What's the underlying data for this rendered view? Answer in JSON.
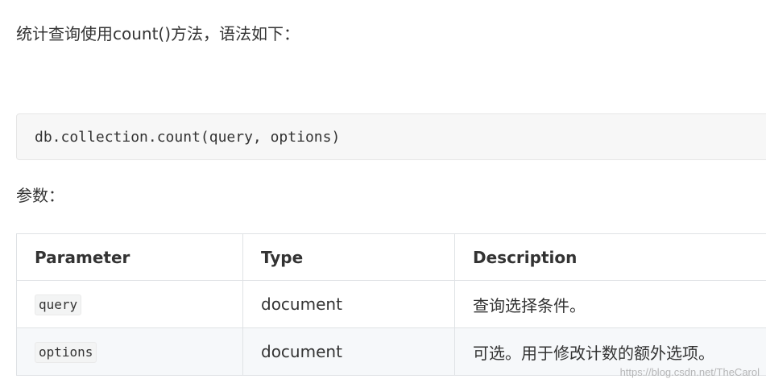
{
  "intro_text": "统计查询使用count()方法，语法如下：",
  "code": "db.collection.count(query, options)",
  "params_label": "参数：",
  "table": {
    "headers": [
      "Parameter",
      "Type",
      "Description"
    ],
    "rows": [
      {
        "param": "query",
        "type": "document",
        "description": "查询选择条件。"
      },
      {
        "param": "options",
        "type": "document",
        "description": "可选。用于修改计数的额外选项。"
      }
    ]
  },
  "watermark": "https://blog.csdn.net/TheCarol"
}
